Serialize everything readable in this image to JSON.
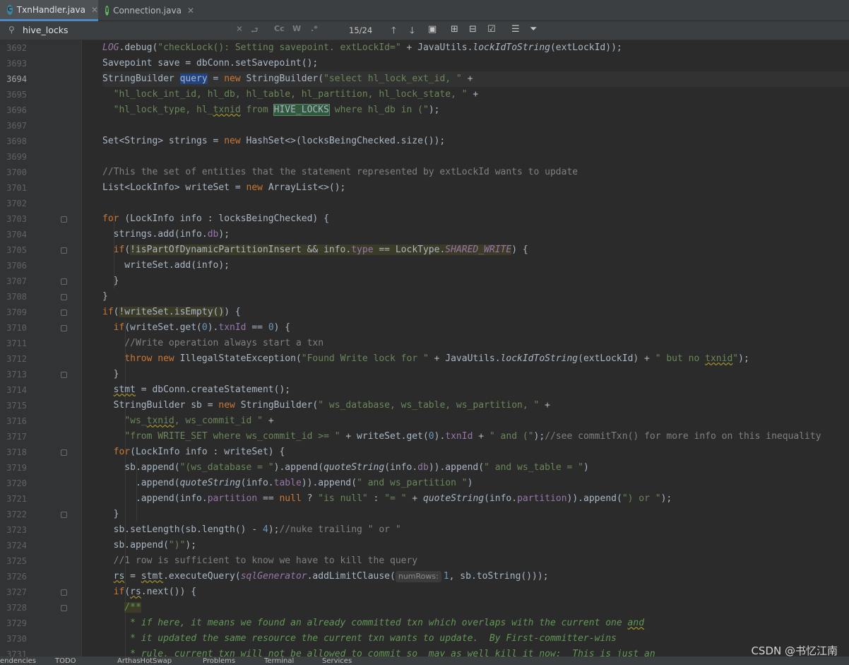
{
  "tabs": [
    {
      "label": "TxnHandler.java",
      "icon": "C",
      "color": "#3e86a0",
      "active": true
    },
    {
      "label": "Connection.java",
      "icon": "I",
      "color": "#5fb85f",
      "active": false
    }
  ],
  "search": {
    "query": "hive_locks",
    "match_count": "15/24",
    "case_label": "Cc",
    "word_label": "W",
    "regex_label": ".*"
  },
  "editor": {
    "line_numbers": [
      "3692",
      "3693",
      "3694",
      "3695",
      "3696",
      "3697",
      "3698",
      "3699",
      "3700",
      "3701",
      "3702",
      "3703",
      "3704",
      "3705",
      "3706",
      "3707",
      "3708",
      "3709",
      "3710",
      "3711",
      "3712",
      "3713",
      "3714",
      "3715",
      "3716",
      "3717",
      "3718",
      "3719",
      "3720",
      "3721",
      "3722",
      "3723",
      "3724",
      "3725",
      "3726",
      "3727",
      "3728",
      "3729",
      "3730",
      "3731"
    ],
    "current_line": "3694",
    "param_hint": "numRows:",
    "lines": [
      [
        [
          "f-sm",
          "LOG"
        ],
        [
          "",
          "."
        ],
        [
          "",
          "debug("
        ],
        [
          "s",
          "\"checkLock(): Setting savepoint. extLockId=\""
        ],
        [
          "",
          " + JavaUtils."
        ],
        [
          "sm",
          "lockIdToString"
        ],
        [
          "",
          "(extLockId));"
        ]
      ],
      [
        [
          "",
          "Savepoint save = dbConn.setSavepoint();"
        ]
      ],
      [
        [
          "",
          "StringBuilder "
        ],
        [
          "hl",
          "query"
        ],
        [
          "",
          " = "
        ],
        [
          "k",
          "new "
        ],
        [
          "",
          "StringBuilder("
        ],
        [
          "s",
          "\"select hl_lock_ext_id, \""
        ],
        [
          "",
          " +"
        ]
      ],
      [
        [
          "",
          "  "
        ],
        [
          "s",
          "\"hl_lock_int_id, hl_db, hl_table, hl_partition, hl_lock_state, \""
        ],
        [
          "",
          " +"
        ]
      ],
      [
        [
          "",
          "  "
        ],
        [
          "s",
          "\"hl_lock_type, hl_"
        ],
        [
          "s-wv",
          "txnid"
        ],
        [
          "s",
          " from "
        ],
        [
          "hl2",
          "HIVE_LOCKS"
        ],
        [
          "s",
          " where hl_db in (\""
        ],
        [
          "",
          ");"
        ]
      ],
      [],
      [
        [
          "",
          "Set<String> strings = "
        ],
        [
          "k",
          "new "
        ],
        [
          "",
          "HashSet<>(locksBeingChecked.size());"
        ]
      ],
      [],
      [
        [
          "c",
          "//This the set of entities that the statement represented by extLockId wants to update"
        ]
      ],
      [
        [
          "",
          "List<LockInfo> writeSet = "
        ],
        [
          "k",
          "new "
        ],
        [
          "",
          "ArrayList<>();"
        ]
      ],
      [],
      [
        [
          "k",
          "for "
        ],
        [
          "",
          "(LockInfo info : locksBeingChecked) {"
        ]
      ],
      [
        [
          "",
          "  strings.add(info."
        ],
        [
          "f",
          "db"
        ],
        [
          "",
          ");"
        ]
      ],
      [
        [
          "",
          "  "
        ],
        [
          "k",
          "if"
        ],
        [
          "",
          "("
        ],
        [
          "yb",
          "!isPartOfDynamicPartitionInsert && info."
        ],
        [
          "yb-f",
          "type"
        ],
        [
          "yb",
          " == LockType."
        ],
        [
          "yb-sf",
          "SHARED_WRITE"
        ],
        [
          "",
          ") {"
        ]
      ],
      [
        [
          "",
          "    writeSet.add(info);"
        ]
      ],
      [
        [
          "",
          "  }"
        ]
      ],
      [
        [
          "",
          "}"
        ]
      ],
      [
        [
          "k",
          "if"
        ],
        [
          "",
          "("
        ],
        [
          "yb",
          "!writeSet.isEmpty()"
        ],
        [
          "",
          ") {"
        ]
      ],
      [
        [
          "",
          "  "
        ],
        [
          "k",
          "if"
        ],
        [
          "",
          "(writeSet.get("
        ],
        [
          "n",
          "0"
        ],
        [
          "",
          ")."
        ],
        [
          "f",
          "txnId"
        ],
        [
          "",
          " == "
        ],
        [
          "n",
          "0"
        ],
        [
          "",
          ") {"
        ]
      ],
      [
        [
          "",
          "    "
        ],
        [
          "c",
          "//Write operation always start a txn"
        ]
      ],
      [
        [
          "",
          "    "
        ],
        [
          "k",
          "throw new "
        ],
        [
          "",
          "IllegalStateException("
        ],
        [
          "s",
          "\"Found Write lock for \""
        ],
        [
          "",
          " + JavaUtils."
        ],
        [
          "sm",
          "lockIdToString"
        ],
        [
          "",
          "(extLockId) + "
        ],
        [
          "s",
          "\" but no "
        ],
        [
          "s-wv",
          "txnid"
        ],
        [
          "s",
          "\""
        ],
        [
          "",
          ");"
        ]
      ],
      [
        [
          "",
          "  }"
        ]
      ],
      [
        [
          "",
          "  "
        ],
        [
          "wv",
          "stmt"
        ],
        [
          "",
          " = dbConn.createStatement();"
        ]
      ],
      [
        [
          "",
          "  StringBuilder sb = "
        ],
        [
          "k",
          "new "
        ],
        [
          "",
          "StringBuilder("
        ],
        [
          "s",
          "\" ws_database, ws_table, ws_partition, \""
        ],
        [
          "",
          " +"
        ]
      ],
      [
        [
          "",
          "    "
        ],
        [
          "s",
          "\"ws_"
        ],
        [
          "s-wv",
          "txnid"
        ],
        [
          "s",
          ", ws_commit_id \""
        ],
        [
          "",
          " +"
        ]
      ],
      [
        [
          "",
          "    "
        ],
        [
          "s",
          "\"from WRITE_SET where ws_commit_id >= \""
        ],
        [
          "",
          " + writeSet.get("
        ],
        [
          "n",
          "0"
        ],
        [
          "",
          ")."
        ],
        [
          "f",
          "txnId"
        ],
        [
          "",
          " + "
        ],
        [
          "s",
          "\" and (\""
        ],
        [
          "",
          ");"
        ],
        [
          "c",
          "//see commitTxn() for more info on this inequality"
        ]
      ],
      [
        [
          "",
          "  "
        ],
        [
          "k",
          "for"
        ],
        [
          "",
          "(LockInfo info : writeSet) {"
        ]
      ],
      [
        [
          "",
          "    sb.append("
        ],
        [
          "s",
          "\"(ws_database = \""
        ],
        [
          "",
          ").append("
        ],
        [
          "sm",
          "quoteString"
        ],
        [
          "",
          "(info."
        ],
        [
          "f",
          "db"
        ],
        [
          "",
          "))"
        ],
        [
          "",
          ".append("
        ],
        [
          "s",
          "\" and ws_table = \""
        ],
        [
          "",
          ")"
        ]
      ],
      [
        [
          "",
          "      .append("
        ],
        [
          "sm",
          "quoteString"
        ],
        [
          "",
          "(info."
        ],
        [
          "f",
          "table"
        ],
        [
          "",
          "))"
        ],
        [
          "",
          ".append("
        ],
        [
          "s",
          "\" and ws_partition \""
        ],
        [
          "",
          ")"
        ]
      ],
      [
        [
          "",
          "      .append(info."
        ],
        [
          "f",
          "partition"
        ],
        [
          "",
          " == "
        ],
        [
          "k",
          "null "
        ],
        [
          "",
          "? "
        ],
        [
          "s",
          "\"is null\""
        ],
        [
          "",
          " : "
        ],
        [
          "s",
          "\"= \""
        ],
        [
          "",
          " + "
        ],
        [
          "sm",
          "quoteString"
        ],
        [
          "",
          "(info."
        ],
        [
          "f",
          "partition"
        ],
        [
          "",
          ")).append("
        ],
        [
          "s",
          "\") or \""
        ],
        [
          "",
          ");"
        ]
      ],
      [
        [
          "",
          "  }"
        ]
      ],
      [
        [
          "",
          "  sb.setLength(sb.length() - "
        ],
        [
          "n",
          "4"
        ],
        [
          "",
          ");"
        ],
        [
          "c",
          "//nuke trailing \" or \""
        ]
      ],
      [
        [
          "",
          "  sb.append("
        ],
        [
          "s",
          "\")\""
        ],
        [
          "",
          ");"
        ]
      ],
      [
        [
          "",
          "  "
        ],
        [
          "c",
          "//1 row is sufficient to know we have to kill the query"
        ]
      ],
      [
        [
          "",
          "  "
        ],
        [
          "wv",
          "rs"
        ],
        [
          "",
          " = "
        ],
        [
          "wv",
          "stmt"
        ],
        [
          "",
          ".executeQuery("
        ],
        [
          "sf",
          "sqlGenerator"
        ],
        [
          "",
          ".addLimitClause("
        ],
        [
          "hint",
          "numRows:"
        ],
        [
          "n",
          "1"
        ],
        [
          "",
          ", sb.toString()));"
        ]
      ],
      [
        [
          "",
          "  "
        ],
        [
          "k",
          "if"
        ],
        [
          "",
          "("
        ],
        [
          "wv",
          "rs"
        ],
        [
          "",
          ".next()) {"
        ]
      ],
      [
        [
          "",
          "    "
        ],
        [
          "yb-dc",
          "/**"
        ]
      ],
      [
        [
          "",
          "     "
        ],
        [
          "dc",
          "* if here, it means we found an already committed txn which overlaps with the current one "
        ],
        [
          "dc-wv",
          "and"
        ]
      ],
      [
        [
          "",
          "     "
        ],
        [
          "dc",
          "* it updated the same resource the current txn wants to update.  By First-committer-wins"
        ]
      ],
      [
        [
          "",
          "     "
        ],
        [
          "dc",
          "* rule, current txn will not be allowed to commit so  may as well kill it now;  This is just an"
        ]
      ]
    ]
  },
  "status_bar": {
    "items": [
      "endencies",
      "TODO",
      "ArthasHotSwap",
      "Problems",
      "Terminal",
      "Services"
    ]
  },
  "watermark": "CSDN @书忆江南"
}
